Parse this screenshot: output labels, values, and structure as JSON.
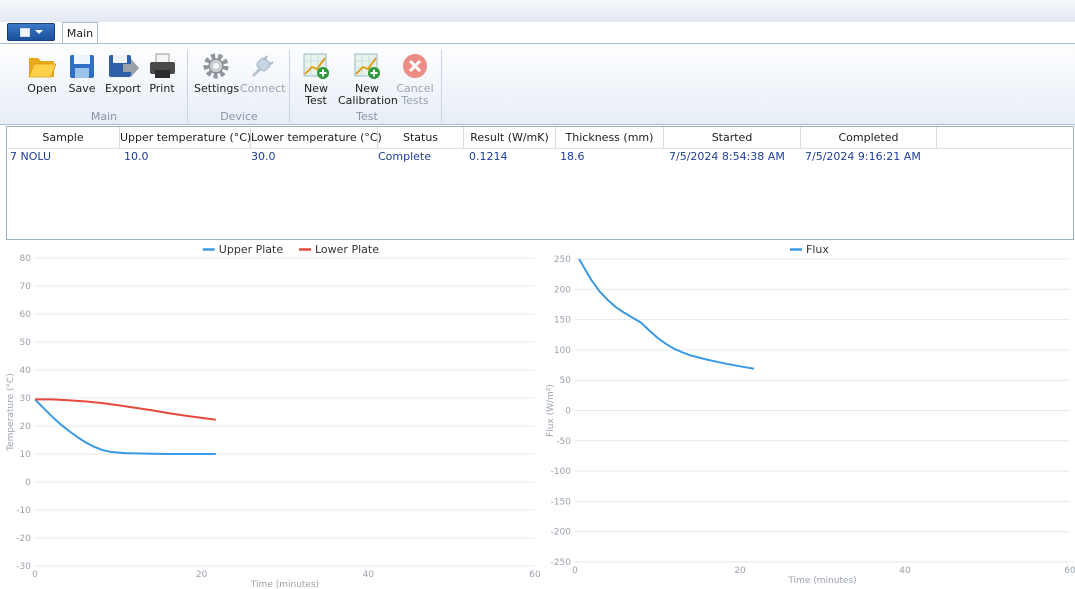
{
  "ribbon": {
    "tab": "Main",
    "groups": [
      {
        "label": "Main",
        "buttons": [
          "Open",
          "Save",
          "Export",
          "Print"
        ]
      },
      {
        "label": "Device",
        "buttons": [
          "Settings",
          "Connect"
        ]
      },
      {
        "label": "Test",
        "buttons": [
          "New\nTest",
          "New\nCalibration",
          "Cancel\nTests"
        ]
      }
    ]
  },
  "table": {
    "columns": [
      "Sample",
      "Upper temperature (°C)",
      "Lower temperature (°C)",
      "Status",
      "Result (W/mK)",
      "Thickness (mm)",
      "Started",
      "Completed"
    ],
    "rows": [
      [
        "7 NOLU",
        "10.0",
        "30.0",
        "Complete",
        "0.1214",
        "18.6",
        "7/5/2024 8:54:38 AM",
        "7/5/2024 9:16:21 AM"
      ]
    ]
  },
  "chart_data": [
    {
      "type": "line",
      "xlabel": "Time (minutes)",
      "ylabel": "Temperature (°C)",
      "xlim": [
        0,
        60
      ],
      "ylim": [
        -30,
        80
      ],
      "xticks": [
        0,
        20,
        40,
        60
      ],
      "yticks": [
        -30,
        -20,
        -10,
        0,
        10,
        20,
        30,
        40,
        50,
        60,
        70,
        80
      ],
      "legend_position": "top-center",
      "series": [
        {
          "name": "Upper Plate",
          "color": "#3a9ae6",
          "x": [
            0,
            1,
            2,
            3,
            4,
            5,
            6,
            7,
            8,
            9,
            10,
            11,
            12,
            14,
            16,
            18,
            20,
            21.7
          ],
          "y": [
            29.5,
            26.5,
            23.5,
            20.8,
            18.4,
            16.2,
            14.3,
            12.7,
            11.5,
            10.8,
            10.5,
            10.3,
            10.2,
            10.1,
            10.0,
            10.0,
            10.0,
            10.0
          ]
        },
        {
          "name": "Lower Plate",
          "color": "#e64a3e",
          "x": [
            0,
            2,
            4,
            6,
            8,
            10,
            12,
            14,
            16,
            18,
            20,
            21.7
          ],
          "y": [
            29.5,
            29.5,
            29.2,
            28.8,
            28.2,
            27.4,
            26.5,
            25.6,
            24.6,
            23.7,
            22.9,
            22.2
          ]
        }
      ]
    },
    {
      "type": "line",
      "xlabel": "Time (minutes)",
      "ylabel": "Flux (W/m²)",
      "xlim": [
        0,
        60
      ],
      "ylim": [
        -250,
        250
      ],
      "xticks": [
        0,
        20,
        40,
        60
      ],
      "yticks": [
        -250,
        -200,
        -150,
        -100,
        -50,
        0,
        50,
        100,
        150,
        200,
        250
      ],
      "legend_position": "top-right",
      "series": [
        {
          "name": "Flux",
          "color": "#3a9ae6",
          "x": [
            0.5,
            1,
            2,
            3,
            4,
            5,
            6,
            7,
            8,
            9,
            10,
            11,
            12,
            13,
            14,
            16,
            18,
            20,
            21.7
          ],
          "y": [
            250,
            238,
            215,
            196,
            182,
            170,
            161,
            153,
            145,
            132,
            120,
            110,
            102,
            96,
            91,
            84,
            78,
            73,
            69
          ]
        }
      ]
    }
  ],
  "colors": {
    "accent": "#1c4f9c",
    "row_text": "#1f3e9a",
    "upper_plate": "#3a9ae6",
    "lower_plate": "#e64a3e"
  }
}
